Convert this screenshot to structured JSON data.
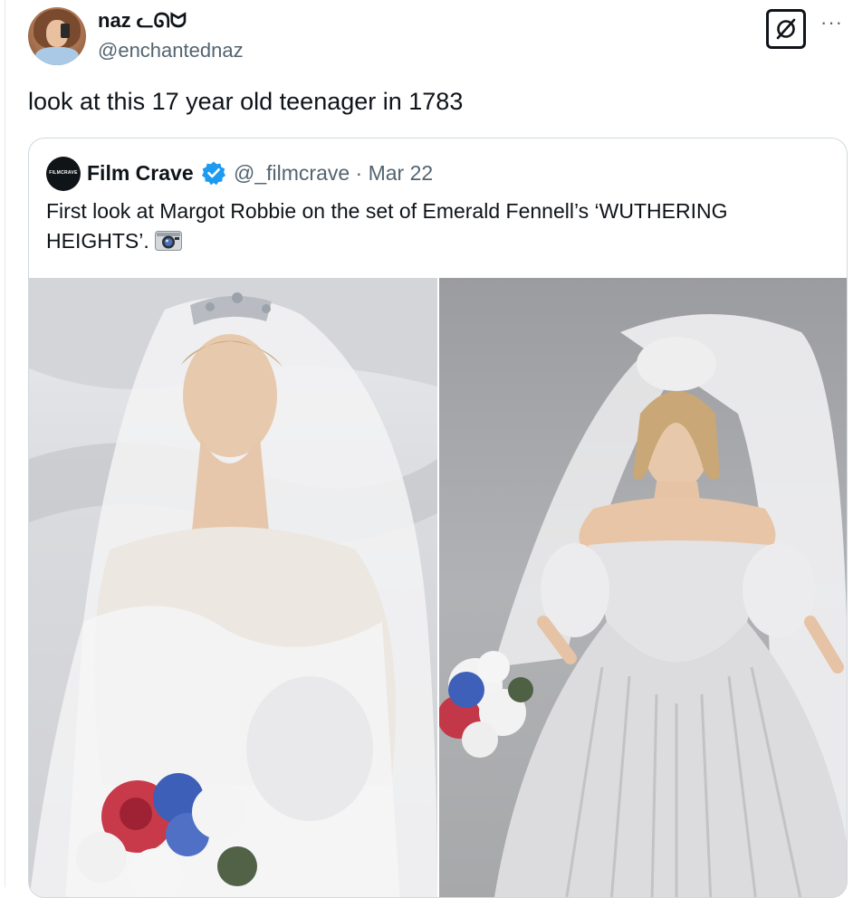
{
  "tweet": {
    "author_name": "naz ᓚᘏᗢ",
    "author_handle": "@enchantednaz",
    "text": "look at this 17 year old teenager in 1783",
    "more_label": "···"
  },
  "quote": {
    "author_name": "Film Crave",
    "author_handle": "@_filmcrave",
    "separator": "·",
    "date": "Mar 22",
    "avatar_text": "FILMCRAVE",
    "text": "First look at Margot Robbie on the set of Emerald Fennell’s ‘WUTHERING HEIGHTS’.",
    "verified_color": "#1d9bf0",
    "camera_emoji": "camera-icon"
  },
  "photos": [
    {
      "name": "photo-bride-veil-closeup"
    },
    {
      "name": "photo-bride-full-gown"
    }
  ],
  "icons": {
    "grok": "grok-slash-icon",
    "more": "more-dots-icon",
    "verified": "verified-badge-icon"
  },
  "colors": {
    "text": "#0f1419",
    "secondary": "#536471",
    "border": "#cfd9de",
    "verified": "#1d9bf0"
  }
}
